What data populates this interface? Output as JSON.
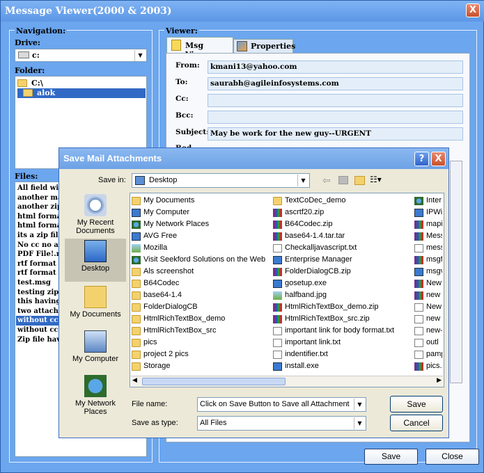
{
  "window": {
    "title": "Message Viewer(2000 & 2003)",
    "close": "X"
  },
  "nav": {
    "group": "Navigation:",
    "drive_label": "Drive:",
    "drive_value": "c:",
    "folder_label": "Folder:",
    "folders": [
      "C:\\",
      "alok"
    ],
    "files_label": "Files:",
    "files": [
      "All field with",
      "another ma",
      "another zip",
      "html format",
      "html format",
      "its a zip file",
      "No cc no att",
      "PDF File!.m",
      "rtf format h",
      "rtf format o",
      "test.msg",
      "testing zip f",
      "this having",
      "two attachm",
      "without cc o",
      "without cc o",
      "Zip file hav"
    ],
    "selected_file_index": 14
  },
  "viewer": {
    "group": "Viewer:",
    "tabs": [
      "Msg Viewer",
      "Properties"
    ],
    "from_label": "From:",
    "from": "kmani13@yahoo.com",
    "to_label": "To:",
    "to": "saurabh@agileinfosystems.com",
    "cc_label": "Cc:",
    "cc": "",
    "bcc_label": "Bcc:",
    "bcc": "",
    "subject_label": "Subject:",
    "subject": "May be work for the new guy--URGENT",
    "body_label": "Bod"
  },
  "buttons": {
    "save": "Save",
    "close": "Close"
  },
  "dialog": {
    "title": "Save Mail Attachments",
    "help": "?",
    "close": "X",
    "save_in_label": "Save in:",
    "save_in_value": "Desktop",
    "places": [
      "My Recent Documents",
      "Desktop",
      "My Documents",
      "My Computer",
      "My Network Places"
    ],
    "col1": [
      [
        "folder",
        "My Documents"
      ],
      [
        "computer",
        "My Computer"
      ],
      [
        "net",
        "My Network Places"
      ],
      [
        "exe",
        "AVG Free"
      ],
      [
        "img",
        "Mozilla"
      ],
      [
        "net",
        "Visit Seekford Solutions on the Web"
      ],
      [
        "folder",
        "Als screenshot"
      ],
      [
        "folder",
        "B64Codec"
      ],
      [
        "folder",
        "base64-1.4"
      ],
      [
        "folder",
        "FolderDialogCB"
      ],
      [
        "folder",
        "HtmlRichTextBox_demo"
      ],
      [
        "folder",
        "HtmlRichTextBox_src"
      ],
      [
        "folder",
        "pics"
      ],
      [
        "folder",
        "project 2 pics"
      ],
      [
        "folder",
        "Storage"
      ]
    ],
    "col2": [
      [
        "folder",
        "TextCoDec_demo"
      ],
      [
        "zip",
        "ascrtf20.zip"
      ],
      [
        "zip",
        "B64Codec.zip"
      ],
      [
        "zip",
        "base64-1.4.tar.tar"
      ],
      [
        "doc",
        "Checkalljavascript.txt"
      ],
      [
        "exe",
        "Enterprise Manager"
      ],
      [
        "zip",
        "FolderDialogCB.zip"
      ],
      [
        "exe",
        "gosetup.exe"
      ],
      [
        "img",
        "halfband.jpg"
      ],
      [
        "zip",
        "HtmlRichTextBox_demo.zip"
      ],
      [
        "zip",
        "HtmlRichTextBox_src.zip"
      ],
      [
        "doc",
        "important link for body format.txt"
      ],
      [
        "doc",
        "important link.txt"
      ],
      [
        "doc",
        "indentifier.txt"
      ],
      [
        "exe",
        "install.exe"
      ]
    ],
    "col3": [
      [
        "net",
        "Inter"
      ],
      [
        "exe",
        "IPWi"
      ],
      [
        "zip",
        "mapi"
      ],
      [
        "zip",
        "Mess"
      ],
      [
        "doc",
        "mess"
      ],
      [
        "zip",
        "msgf"
      ],
      [
        "exe",
        "msgv"
      ],
      [
        "zip",
        "New"
      ],
      [
        "zip",
        "new"
      ],
      [
        "doc",
        "New"
      ],
      [
        "doc",
        "new"
      ],
      [
        "doc",
        "new-"
      ],
      [
        "doc",
        "outl"
      ],
      [
        "doc",
        "pamp"
      ],
      [
        "zip",
        "pics."
      ]
    ],
    "filename_label": "File name:",
    "filename_value": "Click on Save Button to Save all Attachment",
    "type_label": "Save as type:",
    "type_value": "All Files",
    "save_btn": "Save",
    "cancel_btn": "Cancel"
  }
}
